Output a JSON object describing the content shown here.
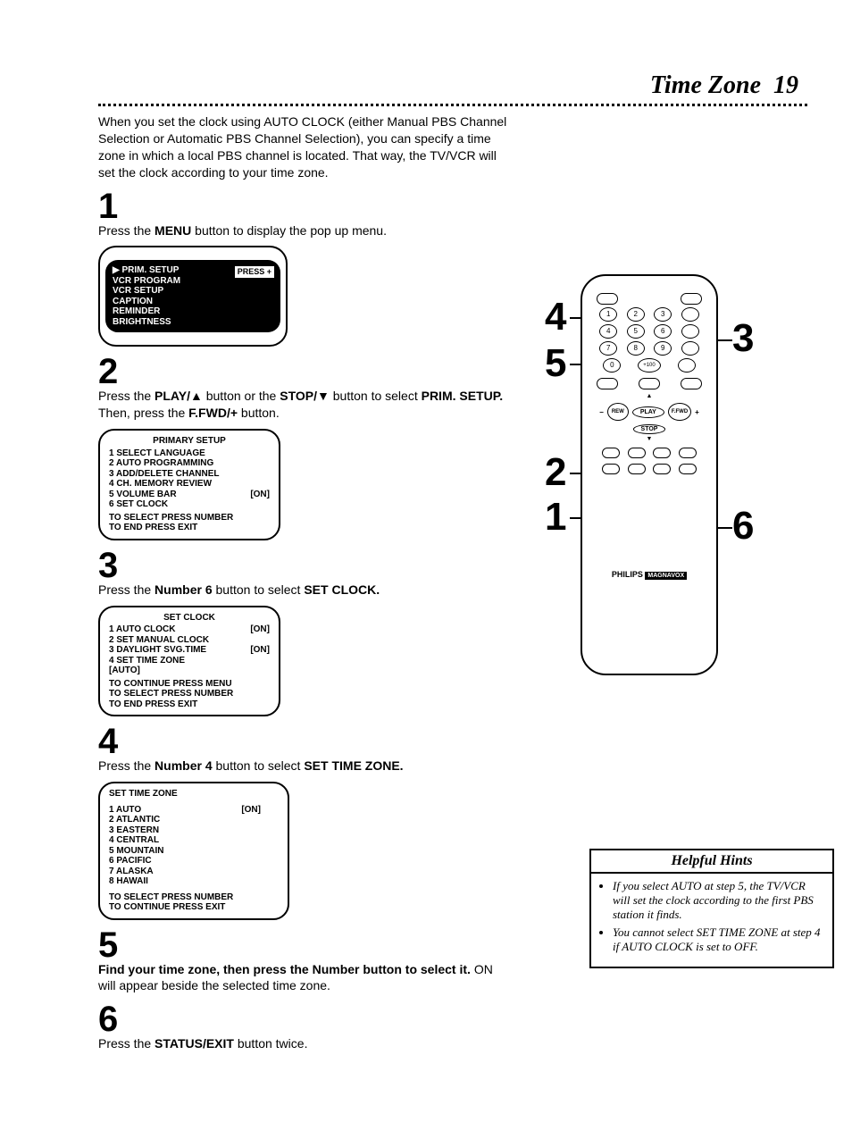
{
  "title": "Time Zone",
  "page_number": "19",
  "intro": "When you set the clock using AUTO CLOCK (either Manual PBS Channel Selection or Automatic PBS Channel Selection), you can specify a time zone in which a local PBS channel is located. That way, the TV/VCR will set the clock according to your time zone.",
  "steps": {
    "s1": {
      "num": "1",
      "text_a": "Press the ",
      "b1": "MENU",
      "text_b": " button  to display the pop up menu."
    },
    "s2": {
      "num": "2",
      "text_a": "Press the ",
      "b1": "PLAY/▲",
      "text_b": " button or the ",
      "b2": "STOP/▼",
      "text_c": " button to select ",
      "b3": "PRIM. SETUP.",
      "text_d": " Then, press the ",
      "b4": "F.FWD/+",
      "text_e": " button."
    },
    "s3": {
      "num": "3",
      "text_a": "Press the ",
      "b1": "Number 6",
      "text_b": " button to select ",
      "b2": "SET CLOCK."
    },
    "s4": {
      "num": "4",
      "text_a": "Press the ",
      "b1": "Number 4",
      "text_b": " button to select ",
      "b2": "SET TIME ZONE."
    },
    "s5": {
      "num": "5",
      "text_a": "Find your time zone, then press the Number button to select it.",
      "text_b": " ON will appear beside the selected time zone."
    },
    "s6": {
      "num": "6",
      "text_a": "Press the ",
      "b1": "STATUS/EXIT",
      "text_b": " button twice."
    }
  },
  "screen1": {
    "items": [
      "PRIM. SETUP",
      "VCR PROGRAM",
      "VCR SETUP",
      "CAPTION",
      "REMINDER",
      "BRIGHTNESS"
    ],
    "press": "PRESS +",
    "cursor": "▶"
  },
  "screen2": {
    "title": "PRIMARY SETUP",
    "items": [
      "1 SELECT LANGUAGE",
      "2 AUTO PROGRAMMING",
      "3 ADD/DELETE CHANNEL",
      "4 CH. MEMORY REVIEW",
      "5 VOLUME BAR",
      "6 SET CLOCK"
    ],
    "on_row": 4,
    "on": "[ON]",
    "foot": [
      "TO SELECT PRESS NUMBER",
      "TO END PRESS EXIT"
    ]
  },
  "screen3": {
    "title": "SET CLOCK",
    "items": [
      "1 AUTO CLOCK",
      "2 SET MANUAL CLOCK",
      "3 DAYLIGHT SVG.TIME",
      "4 SET TIME ZONE",
      "   [AUTO]"
    ],
    "on_rows": [
      0,
      2
    ],
    "on": "[ON]",
    "foot": [
      "TO CONTINUE PRESS MENU",
      "TO SELECT PRESS NUMBER",
      "TO END PRESS EXIT"
    ]
  },
  "screen4": {
    "title": "SET TIME ZONE",
    "items": [
      "1 AUTO",
      "2 ATLANTIC",
      "3 EASTERN",
      "4 CENTRAL",
      "5 MOUNTAIN",
      "6 PACIFIC",
      "7 ALASKA",
      "8 HAWAII"
    ],
    "on_row": 0,
    "on": "[ON]",
    "foot": [
      "TO SELECT PRESS NUMBER",
      "TO CONTINUE PRESS EXIT"
    ]
  },
  "remote": {
    "labels": {
      "r1": "1",
      "r2": "2",
      "r3": "3",
      "r4": "4",
      "r5": "5",
      "r6": "6"
    },
    "play": "PLAY",
    "rew": "REW",
    "ffwd": "F.FWD",
    "stop": "STOP",
    "brand1": "PHILIPS",
    "brand2": "MAGNAVOX",
    "numbers": [
      "1",
      "2",
      "3",
      "4",
      "5",
      "6",
      "7",
      "8",
      "9",
      "0",
      "+100"
    ]
  },
  "hints": {
    "title": "Helpful Hints",
    "items": [
      "If you select AUTO at step 5, the TV/VCR will set the clock according to the first PBS station it finds.",
      "You cannot select SET TIME ZONE at step 4 if AUTO CLOCK is set to OFF."
    ]
  }
}
